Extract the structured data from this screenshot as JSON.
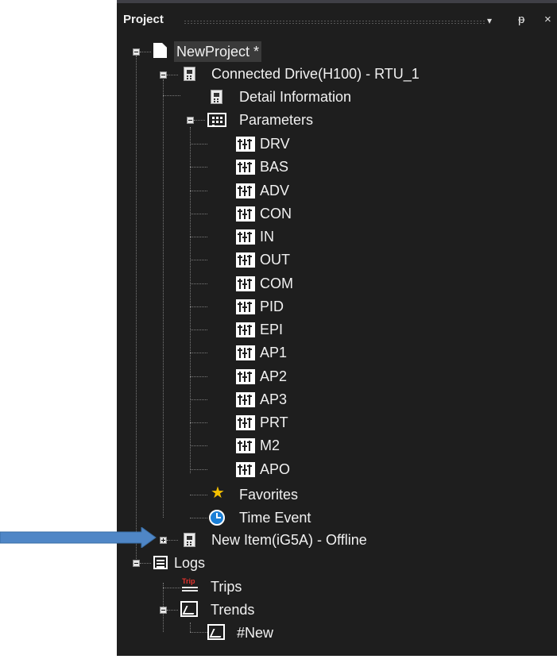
{
  "panel": {
    "title": "Project",
    "dropdown_glyph": "▾",
    "pin_glyph": "ᵽ",
    "close_glyph": "×"
  },
  "tree": {
    "root": "NewProject *",
    "drive": "Connected Drive(H100) - RTU_1",
    "detail": "Detail Information",
    "parameters": "Parameters",
    "groups": [
      "DRV",
      "BAS",
      "ADV",
      "CON",
      "IN",
      "OUT",
      "COM",
      "PID",
      "EPI",
      "AP1",
      "AP2",
      "AP3",
      "PRT",
      "M2",
      "APO"
    ],
    "favorites": "Favorites",
    "time_event": "Time Event",
    "new_item": "New Item(iG5A) - Offline",
    "logs": "Logs",
    "trips": "Trips",
    "trip_badge": "Trip",
    "trends": "Trends",
    "new_trend": "#New"
  },
  "colors": {
    "panel_bg": "#1e1e1e",
    "text": "#f1f1f1",
    "arrow": "#4f86c6",
    "star": "#f5c000",
    "clock": "#1b7fd6",
    "trip_badge": "#e4332e"
  },
  "icons": {
    "root": "document-icon",
    "drive": "drive-icon",
    "parameters": "parameter-grid-icon",
    "group": "parameter-group-icon",
    "favorites": "star-icon",
    "time_event": "clock-icon",
    "logs": "list-icon",
    "trips": "trip-icon",
    "trends": "trend-chart-icon",
    "annotation": "arrow-icon"
  }
}
